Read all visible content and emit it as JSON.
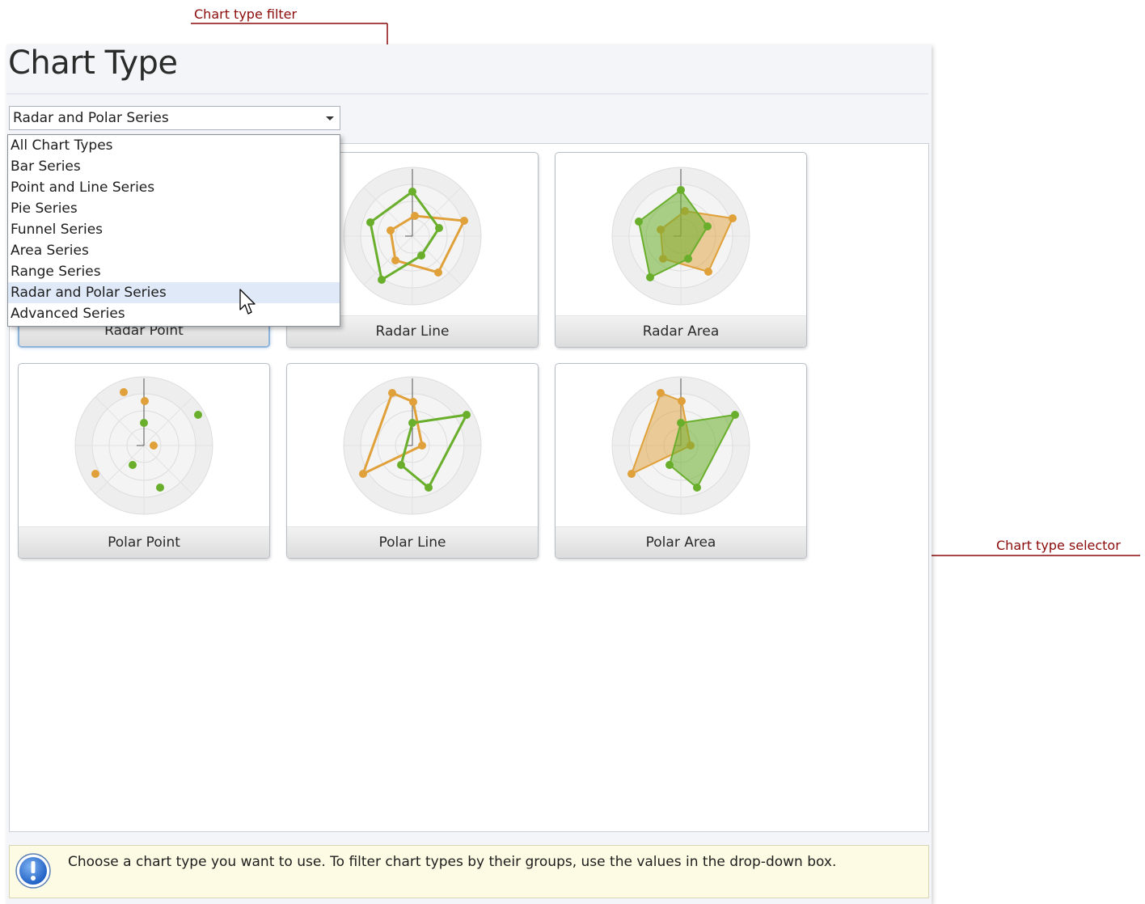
{
  "annotations": {
    "filter_label": "Chart type filter",
    "selector_label": "Chart type selector",
    "color": "#8b0a0a"
  },
  "window": {
    "title": "Chart Type"
  },
  "filter": {
    "selected": "Radar and Polar Series",
    "options": [
      "All Chart Types",
      "Bar Series",
      "Point and Line Series",
      "Pie Series",
      "Funnel Series",
      "Area Series",
      "Range Series",
      "Radar and Polar Series",
      "Advanced Series"
    ]
  },
  "gallery": {
    "tiles": [
      {
        "label": "Radar Point",
        "icon": "radar-point-chart",
        "selected": true
      },
      {
        "label": "Radar Line",
        "icon": "radar-line-chart",
        "selected": false
      },
      {
        "label": "Radar Area",
        "icon": "radar-area-chart",
        "selected": false
      },
      {
        "label": "Polar Point",
        "icon": "polar-point-chart",
        "selected": false
      },
      {
        "label": "Polar Line",
        "icon": "polar-line-chart",
        "selected": false
      },
      {
        "label": "Polar Area",
        "icon": "polar-area-chart",
        "selected": false
      }
    ]
  },
  "info": {
    "icon": "info-icon",
    "text": "Choose a chart type you want to use. To filter chart types by their groups, use the values in the drop-down box."
  },
  "colors": {
    "series_green": "#6aaf2c",
    "series_orange": "#e0a03a",
    "highlight": "#dfe9f8",
    "info_background": "#fdfbe3"
  }
}
